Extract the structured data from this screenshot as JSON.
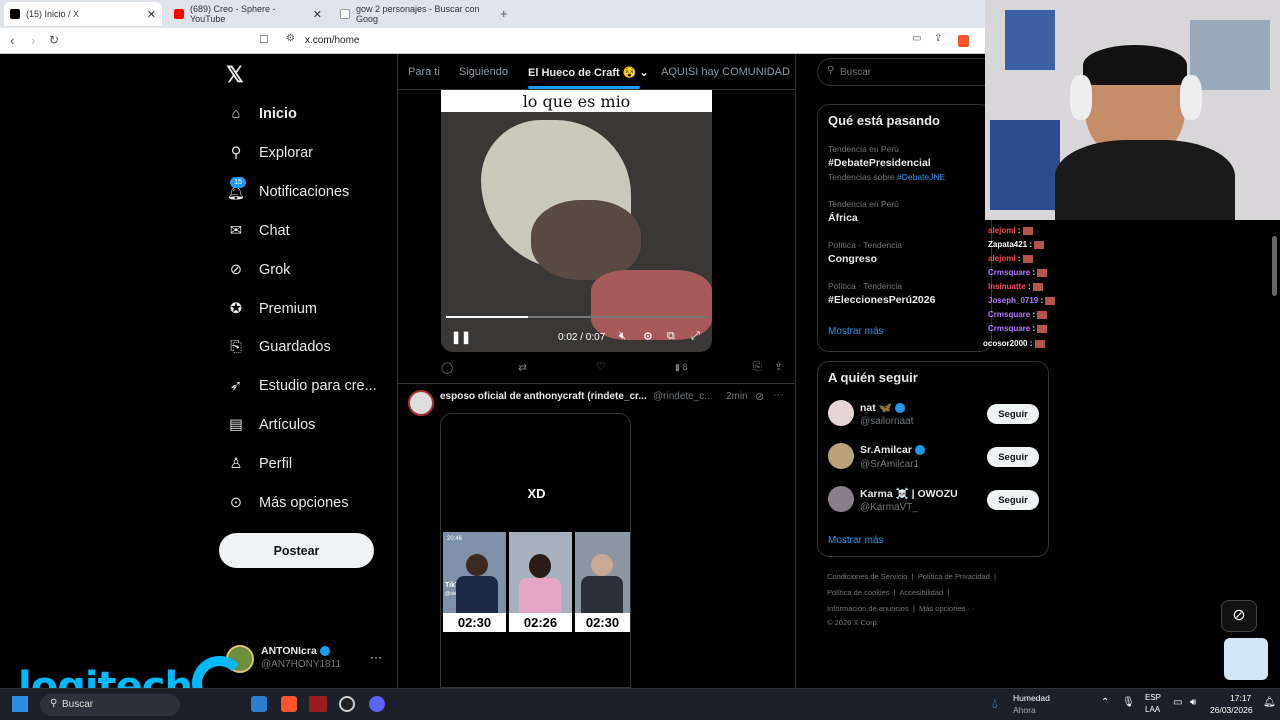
{
  "browser": {
    "tabs": [
      {
        "label": "(15) Inicio / X",
        "active": true
      },
      {
        "label": "(689) Creo - Sphere - YouTube",
        "active": false
      },
      {
        "label": "gow 2 personajes - Buscar con Goog",
        "active": false
      }
    ],
    "url": "x.com/home"
  },
  "sidebar": {
    "items": [
      {
        "label": "Inicio",
        "icon": "home-icon"
      },
      {
        "label": "Explorar",
        "icon": "search-icon"
      },
      {
        "label": "Notificaciones",
        "icon": "bell-icon",
        "badge": "15"
      },
      {
        "label": "Chat",
        "icon": "mail-icon"
      },
      {
        "label": "Grok",
        "icon": "grok-icon"
      },
      {
        "label": "Premium",
        "icon": "premium-icon"
      },
      {
        "label": "Guardados",
        "icon": "bookmark-icon"
      },
      {
        "label": "Estudio para cre...",
        "icon": "rocket-icon"
      },
      {
        "label": "Artículos",
        "icon": "article-icon"
      },
      {
        "label": "Perfil",
        "icon": "person-icon"
      },
      {
        "label": "Más opciones",
        "icon": "more-icon"
      }
    ],
    "post_label": "Postear",
    "account": {
      "name": "ANTONIcra",
      "handle": "@AN7HONY1811"
    }
  },
  "feed": {
    "tabs": [
      "Para ti",
      "Siguiendo",
      "El Hueco de Craft",
      "AQUISI hay COMUNIDAD"
    ],
    "video": {
      "caption": "lo que es mio",
      "time": "0:02 / 0:07",
      "views": "8"
    },
    "post2": {
      "author": "esposo oficial de anthonycraft (rindete_cr...",
      "handle": "@rindete_c...",
      "age": "2min",
      "text": "XD",
      "tiktok_label": "TikTok",
      "tiktok_user": "@alex.stark...",
      "clip_time": "20:46",
      "timers": [
        "02:30",
        "02:26",
        "02:30"
      ]
    }
  },
  "right": {
    "search_placeholder": "Buscar",
    "trends_title": "Qué está pasando",
    "trends": [
      {
        "context": "Tendencia en Perú",
        "name": "#DebatePresidencial",
        "extra": "Tendencias sobre",
        "extra_link": "#DebateJNE"
      },
      {
        "context": "Tendencia en Perú",
        "name": "África"
      },
      {
        "context": "Política · Tendencia",
        "name": "Congreso"
      },
      {
        "context": "Política · Tendencia",
        "name": "#EleccionesPerú2026"
      }
    ],
    "show_more": "Mostrar más",
    "follow_title": "A quién seguir",
    "follow": [
      {
        "name": "nat 🦋",
        "handle": "@sailornaat"
      },
      {
        "name": "Sr.Amilcar",
        "handle": "@SrAmilcar1"
      },
      {
        "name": "Karma ☠️ | OWOZU",
        "handle": "@KarmaVT_"
      }
    ],
    "follow_label": "Seguir",
    "footer": [
      "Condiciones de Servicio",
      "Política de Privacidad",
      "Política de cookies",
      "Accesibilidad",
      "Información de anuncios",
      "Más opciones ···",
      "© 2026 X Corp."
    ]
  },
  "overlay": {
    "chat": [
      {
        "user": "alejoml",
        "color": "#ff4b4b"
      },
      {
        "user": "Zapata421",
        "color": "#ffffff"
      },
      {
        "user": "alejoml",
        "color": "#ff4b4b"
      },
      {
        "user": "Crmsquare",
        "color": "#b57cff"
      },
      {
        "user": "Insinuatte",
        "color": "#ff4b6e"
      },
      {
        "user": "Joseph_0719",
        "color": "#b57cff"
      },
      {
        "user": "Crmsquare",
        "color": "#b57cff"
      },
      {
        "user": "Crmsquare",
        "color": "#b57cff"
      },
      {
        "user": "ocosor2000",
        "color": "#ffffff"
      }
    ],
    "brand": "logitech"
  },
  "taskbar": {
    "search": "Buscar",
    "weather_title": "Humedad",
    "weather_sub": "Ahora",
    "lang": "ESP",
    "lang2": "LAA",
    "time": "17:17",
    "date": "26/03/2026"
  }
}
